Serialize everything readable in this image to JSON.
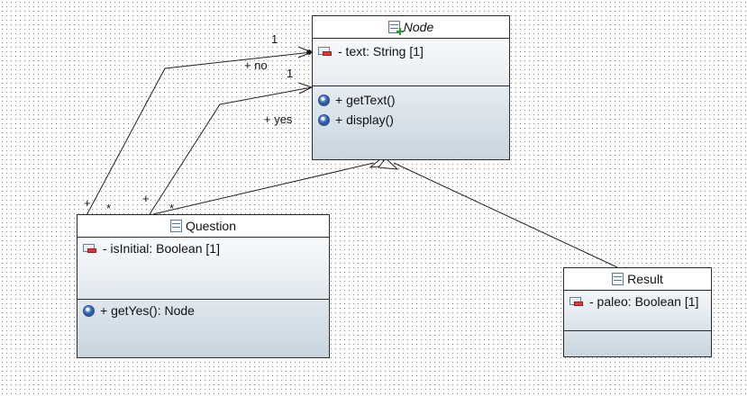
{
  "classes": {
    "node": {
      "name": "Node",
      "abstract": true,
      "attributes": [
        "- text: String [1]"
      ],
      "operations": [
        "+ getText()",
        "+ display()"
      ]
    },
    "question": {
      "name": "Question",
      "attributes": [
        "- isInitial: Boolean [1]"
      ],
      "operations": [
        "+ getYes(): Node"
      ]
    },
    "result": {
      "name": "Result",
      "attributes": [
        "- paleo: Boolean [1]"
      ],
      "operations": []
    }
  },
  "associations": {
    "no": {
      "role": "+ no",
      "target_multiplicity": "1",
      "source_role_mark": "+",
      "source_multiplicity": "*"
    },
    "yes": {
      "role": "+ yes",
      "target_multiplicity": "1",
      "source_role_mark": "+",
      "source_multiplicity": "*"
    }
  },
  "generalizations": [
    "Question → Node",
    "Result → Node"
  ]
}
